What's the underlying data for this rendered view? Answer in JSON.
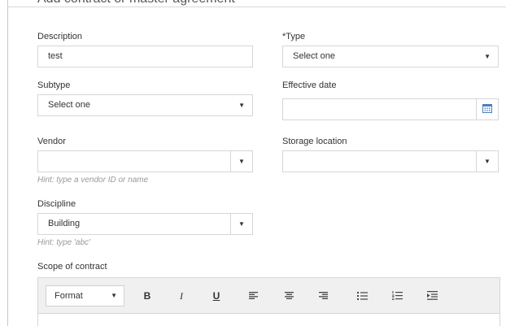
{
  "header": {
    "title": "Add contract or master agreement"
  },
  "form": {
    "description": {
      "label": "Description",
      "value": "test"
    },
    "type": {
      "label": "*Type",
      "selected": "Select one"
    },
    "subtype": {
      "label": "Subtype",
      "selected": "Select one"
    },
    "effective_date": {
      "label": "Effective date",
      "value": ""
    },
    "vendor": {
      "label": "Vendor",
      "value": "",
      "hint": "Hint: type a vendor ID or name"
    },
    "storage_location": {
      "label": "Storage location",
      "value": ""
    },
    "discipline": {
      "label": "Discipline",
      "selected": "Building",
      "hint": "Hint: type 'abc'"
    },
    "scope": {
      "label": "Scope of contract"
    }
  },
  "editor": {
    "format_label": "Format",
    "bold": "B",
    "italic": "I",
    "underline": "U"
  },
  "icons": {
    "dropdown": "dropdown-arrow-icon",
    "calendar": "calendar-icon",
    "align_left": "align-left-icon",
    "align_center": "align-center-icon",
    "align_right": "align-right-icon",
    "bullet_list": "bullet-list-icon",
    "numbered_list": "numbered-list-icon",
    "indent": "indent-icon"
  },
  "colors": {
    "calendar": "#4a7fc0",
    "border": "#d6d6d6",
    "toolbar_bg": "#f0f0f0",
    "hint": "#999999"
  }
}
